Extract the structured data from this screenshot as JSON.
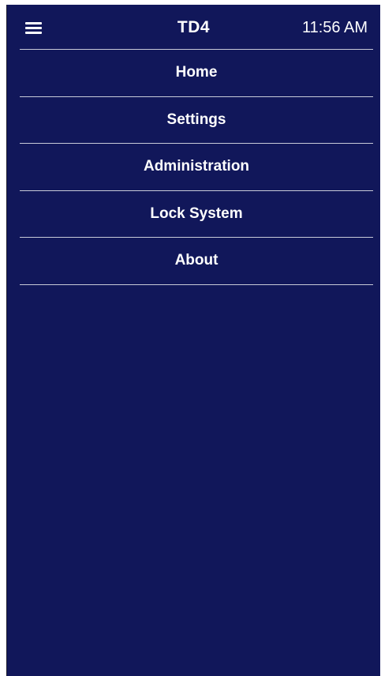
{
  "header": {
    "menu_icon": "hamburger-menu-icon",
    "title": "TD4",
    "time": "11:56 AM"
  },
  "menu": {
    "items": [
      {
        "label": "Home"
      },
      {
        "label": "Settings"
      },
      {
        "label": "Administration"
      },
      {
        "label": "Lock System"
      },
      {
        "label": "About"
      }
    ]
  },
  "colors": {
    "background": "#11175a",
    "text": "#ffffff",
    "divider": "#c8cad8"
  }
}
